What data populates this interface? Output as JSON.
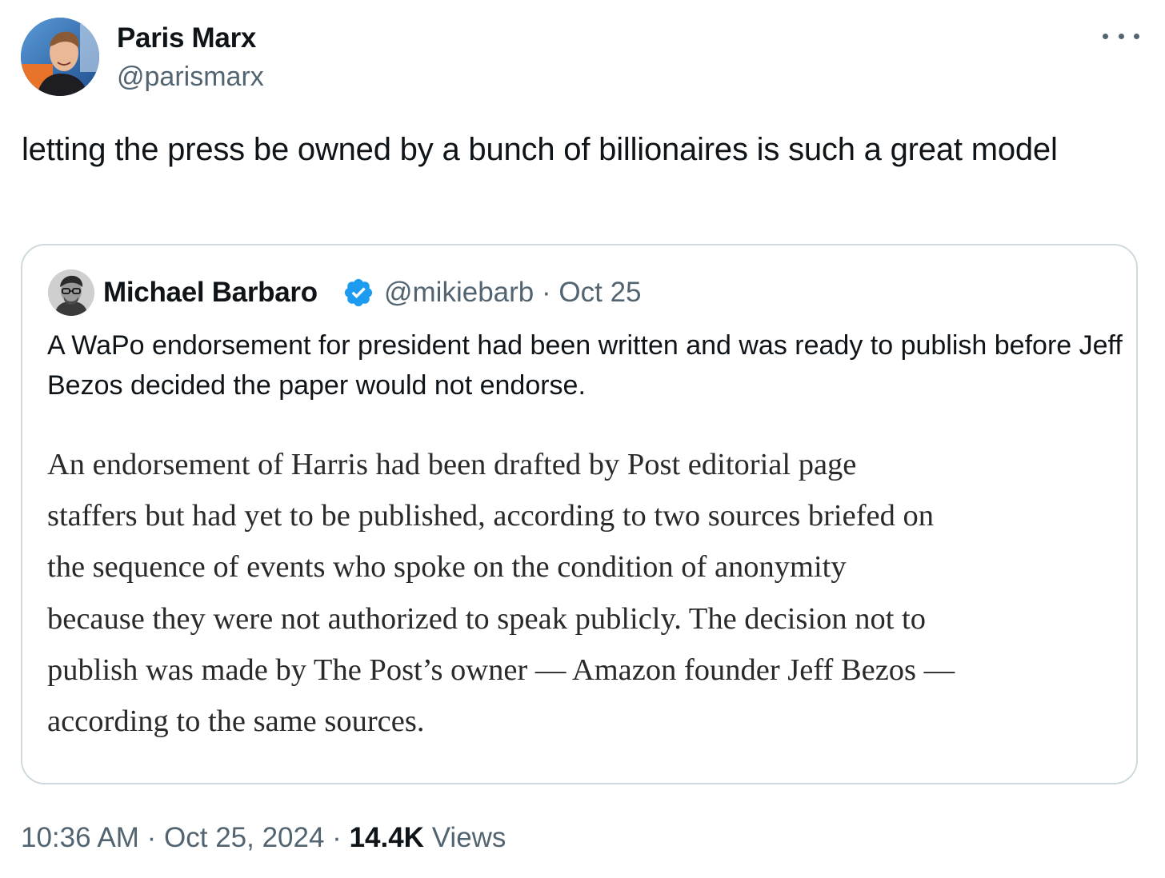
{
  "author": {
    "name": "Paris Marx",
    "handle": "@parismarx"
  },
  "menu": {
    "more_icon": "more-horizontal-icon"
  },
  "tweet": {
    "text": "letting the press be owned by a bunch of billionaires is such a great model"
  },
  "quoted_tweet": {
    "name": "Michael Barbaro",
    "verified_icon": "verified-badge-icon",
    "handle": "@mikiebarb",
    "separator": "·",
    "date": "Oct 25",
    "text": "A WaPo endorsement for president had been written and was ready to publish before Jeff Bezos decided the paper would not endorse.",
    "excerpt_lines": [
      "An endorsement of Harris had been drafted by Post editorial page",
      "staffers but had yet to be published, according to two sources briefed on",
      "the sequence of events who spoke on the condition of anonymity",
      "because they were not authorized to speak publicly. The decision not to",
      "publish was made by The Post’s owner — Amazon founder Jeff Bezos —",
      "according to the same sources."
    ]
  },
  "footer": {
    "time": "10:36 AM",
    "separator": "·",
    "date": "Oct 25, 2024",
    "views_count": "14.4K",
    "views_label": "Views"
  },
  "colors": {
    "text_primary": "#0f1419",
    "text_secondary": "#536471",
    "border": "#cfd9de",
    "verified_blue": "#1d9bf0"
  }
}
